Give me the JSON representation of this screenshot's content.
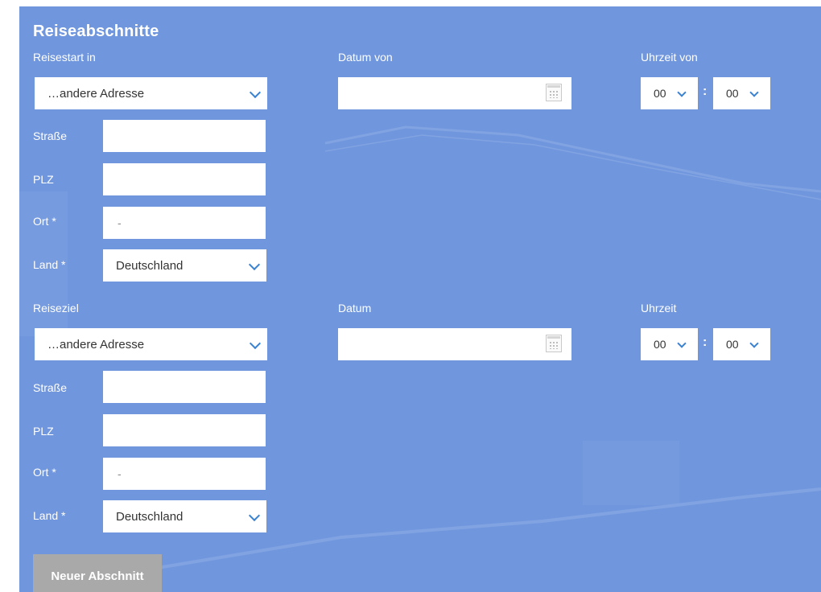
{
  "section_title": "Reiseabschnitte",
  "start": {
    "label": "Reisestart in",
    "address_select": "…andere Adresse",
    "date_label": "Datum von",
    "time_label": "Uhrzeit von",
    "hour": "00",
    "minute": "00",
    "street_label": "Straße",
    "street_value": "",
    "zip_label": "PLZ",
    "zip_value": "",
    "city_label": "Ort *",
    "city_value": "-",
    "country_label": "Land *",
    "country_value": "Deutschland"
  },
  "destination": {
    "label": "Reiseziel",
    "address_select": "…andere Adresse",
    "date_label": "Datum",
    "time_label": "Uhrzeit",
    "hour": "00",
    "minute": "00",
    "street_label": "Straße",
    "street_value": "",
    "zip_label": "PLZ",
    "zip_value": "",
    "city_label": "Ort *",
    "city_value": "-",
    "country_label": "Land *",
    "country_value": "Deutschland"
  },
  "time_separator": ":",
  "new_section_button": "Neuer Abschnitt",
  "colors": {
    "panel": "#7096dd",
    "chevron": "#3b82d0",
    "button": "#a9a9a9"
  },
  "icons": {
    "calendar": "calendar-icon",
    "dropdown": "chevron-down-icon"
  }
}
